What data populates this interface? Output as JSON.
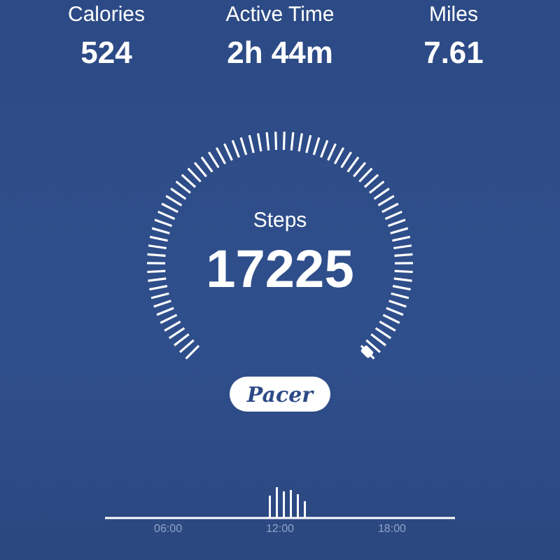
{
  "stats": [
    {
      "label": "Calories",
      "value": "524"
    },
    {
      "label": "Active Time",
      "value": "2h 44m"
    },
    {
      "label": "Miles",
      "value": "7.61"
    }
  ],
  "gauge": {
    "label": "Steps",
    "value": "17225"
  },
  "brand": "Pacer",
  "timeline": {
    "labels": [
      "06:00",
      "12:00",
      "18:00"
    ]
  }
}
